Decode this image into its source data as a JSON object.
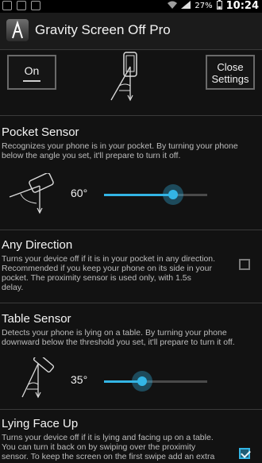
{
  "status_bar": {
    "battery": "27%",
    "time": "10:24"
  },
  "app": {
    "title": "Gravity Screen Off Pro"
  },
  "top_controls": {
    "on_label": "On",
    "close_line1": "Close",
    "close_line2": "Settings"
  },
  "pocket_sensor": {
    "title": "Pocket Sensor",
    "desc_lines": [
      "Recognizes your phone is in your pocket. By turning your phone",
      "below the angle you set, it'll prepare to turn it off."
    ],
    "angle_label": "60°",
    "slider_fraction": 0.67
  },
  "any_direction": {
    "title": "Any Direction",
    "desc_lines": [
      "Turns your device off if it is in your pocket in any direction.",
      "Recommended if you keep your phone on its side in your",
      "pocket. The proximity sensor is used only, with 1.5s",
      "delay."
    ],
    "checked": false
  },
  "table_sensor": {
    "title": "Table Sensor",
    "desc_lines": [
      "Detects your phone is lying on a table. By turning your phone",
      "downward below the threshold you set, it'll prepare to turn it off."
    ],
    "angle_label": "35°",
    "slider_fraction": 0.37
  },
  "lying_face_up": {
    "title": "Lying Face Up",
    "desc_lines": [
      "Turns your device off if it is lying and facing up on a table.",
      "You can turn it back on by swiping over the proximity",
      "sensor. To keep the screen on the first swipe add an extra"
    ],
    "checked": true
  },
  "colors": {
    "accent": "#33b5e5",
    "background": "#121212"
  }
}
